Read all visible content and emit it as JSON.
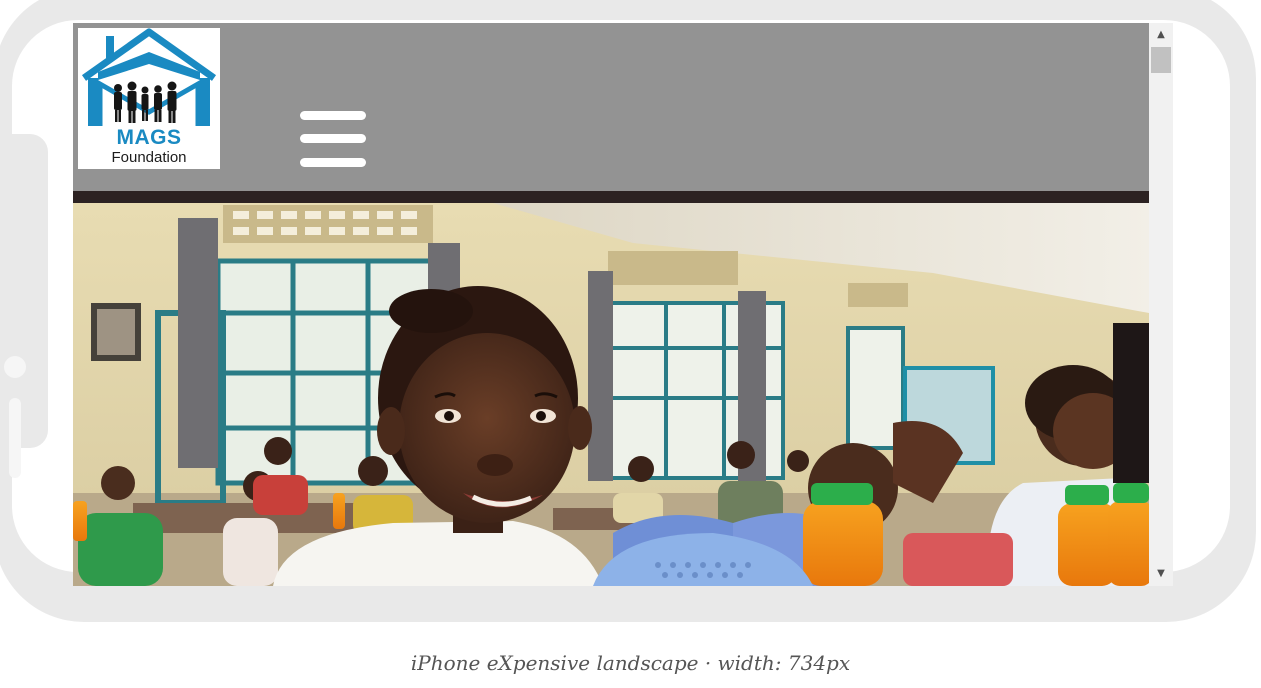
{
  "logo": {
    "name": "MAGS",
    "subtitle": "Foundation",
    "brand_color": "#1a8ac2"
  },
  "header": {
    "background": "#939393",
    "menu_icon": "hamburger-menu-icon"
  },
  "hero": {
    "description_icon": "classroom-photo"
  },
  "scrollbar": {
    "up_arrow": "▲",
    "down_arrow": "▼"
  },
  "caption": "iPhone eXpensive landscape · width: 734px"
}
